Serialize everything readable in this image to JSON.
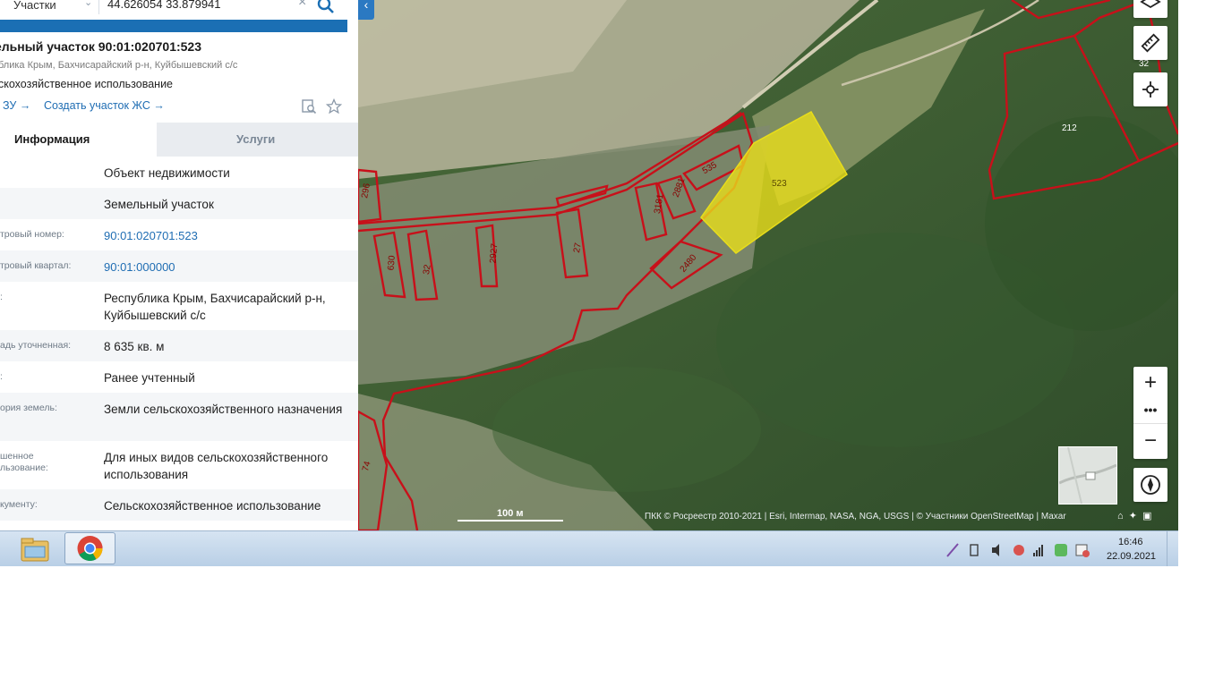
{
  "search": {
    "type_label": "Участки",
    "query": "44.626054 33.879941"
  },
  "parcel": {
    "title": "ельный участок 90:01:020701:523",
    "address": "блика Крым, Бахчисарайский р-н, Куйбышевский с/с",
    "use": "скохозяйственное использование",
    "action_zu": "ЗУ →",
    "action_create": "Создать участок ЖС →"
  },
  "tabs": {
    "info": "Информация",
    "services": "Услуги"
  },
  "rows": [
    {
      "label": "",
      "value": "Объект недвижимости"
    },
    {
      "label": "",
      "value": "Земельный участок"
    },
    {
      "label": "тровый номер:",
      "value": "90:01:020701:523"
    },
    {
      "label": "тровый квартал:",
      "value": "90:01:000000"
    },
    {
      "label": ":",
      "value": "Республика Крым, Бахчисарайский р-н, Куйбышевский с/с"
    },
    {
      "label": "адь уточненная:",
      "value": "8 635 кв. м"
    },
    {
      "label": ":",
      "value": "Ранее учтенный"
    },
    {
      "label": "ория земель:",
      "value": "Земли сельскохозяйственного назначения"
    },
    {
      "label1": "шенное",
      "label2": "льзование:",
      "value": "Для иных видов сельскохозяйственного использования"
    },
    {
      "label": "кументу:",
      "value": "Сельскохозяйственное использование"
    }
  ],
  "map": {
    "parcel_labels": [
      "523",
      "535",
      "2881",
      "3181",
      "2480",
      "27",
      "2927",
      "32",
      "630",
      "296",
      "212",
      "32",
      "74"
    ],
    "scale_label": "100 м",
    "attribution": "ПКК © Росреестр 2010-2021 | Esri, Intermap, NASA, NGA, USGS | © Участники OpenStreetMap | Maxar",
    "zoom_in": "+",
    "zoom_more": "•••",
    "zoom_out": "−"
  },
  "taskbar": {
    "time": "16:46",
    "date": "22.09.2021"
  },
  "colors": {
    "accent": "#1b6fb4",
    "parcel_border": "#c8101a",
    "selected_parcel": "#e8dd1a"
  }
}
